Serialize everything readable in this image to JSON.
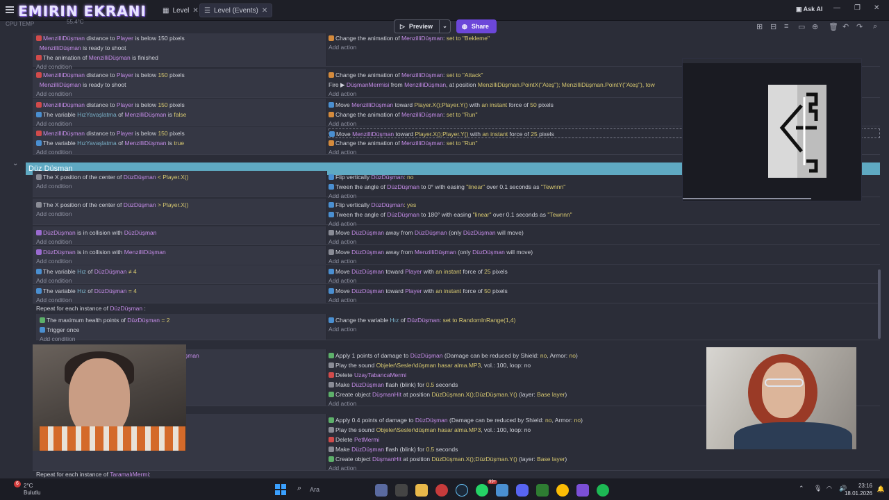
{
  "stream": {
    "title": "EMIRIN EKRANI",
    "temp": "55.4°C",
    "sys": "CPU TEMP"
  },
  "tabs": [
    {
      "label": "Level",
      "active": false
    },
    {
      "label": "Level (Events)",
      "active": true
    }
  ],
  "toolbar": {
    "preview": "Preview",
    "share": "Share",
    "ask_ai": "Ask AI"
  },
  "events": {
    "r1": {
      "c1": "MenzilliDüşman",
      "c1b": "distance to",
      "c1c": "Player",
      "c1d": "is below 150 pixels",
      "c2a": "MenzilliDüşman",
      "c2b": "is ready to shoot",
      "c3a": "The animation of",
      "c3b": "MenzilliDüşman",
      "c3c": "is finished",
      "a1": "Change the animation of",
      "a1b": "MenzilliDüşman",
      "a1c": "set to",
      "a1d": "\"Bekleme\""
    },
    "r2": {
      "c1": "MenzilliDüşman",
      "c1b": "distance to",
      "c1c": "Player",
      "c1d": "is below",
      "c1e": "150",
      "c1f": "pixels",
      "c2a": "MenzilliDüşman",
      "c2b": "is ready to shoot",
      "a1": "Change the animation of",
      "a1b": "MenzilliDüşman",
      "a1c": "set to",
      "a1d": "\"Attack\"",
      "a2": "Fire",
      "a2b": "DüşmanMermisi",
      "a2c": "from",
      "a2d": "MenzilliDüşman",
      "a2e": ", at position",
      "a2f": "MenzilliDüşman.PointX(\"Ateş\"); MenzilliDüşman.PointY(\"Ateş\"), tow"
    },
    "r3": {
      "c1": "MenzilliDüşman",
      "c1b": "distance to",
      "c1c": "Player",
      "c1d": "is below",
      "c1e": "150",
      "c1f": "pixels",
      "c2a": "The variable",
      "c2b": "HızYavaşlatma",
      "c2c": "of",
      "c2d": "MenzilliDüşman",
      "c2e": "is",
      "c2f": "false",
      "a1": "Move",
      "a1b": "MenzilliDüşman",
      "a1c": "toward",
      "a1d": "Player.X();Player.Y()",
      "a1e": "with",
      "a1f": "an instant",
      "a1g": "force of",
      "a1h": "50",
      "a1i": "pixels",
      "a2": "Change the animation of",
      "a2b": "MenzilliDüşman",
      "a2c": "set to",
      "a2d": "\"Run\""
    },
    "r4": {
      "c1": "MenzilliDüşman",
      "c1b": "distance to",
      "c1c": "Player",
      "c1d": "is below",
      "c1e": "150",
      "c1f": "pixels",
      "c2a": "The variable",
      "c2b": "HızYavaşlatma",
      "c2c": "of",
      "c2d": "MenzilliDüşman",
      "c2e": "is",
      "c2f": "true",
      "a1": "Move",
      "a1b": "MenzilliDüşman",
      "a1c": "toward",
      "a1d": "Player.X();Player.Y()",
      "a1e": "with",
      "a1f": "an instant",
      "a1g": "force of",
      "a1h": "25",
      "a1i": "pixels",
      "a2": "Change the animation of",
      "a2b": "MenzilliDüşman",
      "a2c": "set to",
      "a2d": "\"Run\""
    },
    "group": "Düz Düşman",
    "g1": {
      "c1": "The X position of the center of",
      "c1b": "DüzDüşman",
      "c1c": "< Player.X()",
      "a1": "Flip vertically",
      "a1b": "DüzDüşman",
      "a1c": ": no",
      "a2": "Tween the angle of",
      "a2b": "DüzDüşman",
      "a2c": "to 0° with easing",
      "a2d": "\"linear\"",
      "a2e": "over 0.1 seconds as",
      "a2f": "\"Tewnnn\""
    },
    "g2": {
      "c1": "The X position of the center of",
      "c1b": "DüzDüşman",
      "c1c": "> Player.X()",
      "a1": "Flip vertically",
      "a1b": "DüzDüşman",
      "a1c": ": yes",
      "a2": "Tween the angle of",
      "a2b": "DüzDüşman",
      "a2c": "to 180° with easing",
      "a2d": "\"linear\"",
      "a2e": "over 0.1 seconds as",
      "a2f": "\"Tewnnn\""
    },
    "g3": {
      "c1": "DüzDüşman",
      "c1b": "is in collision with",
      "c1c": "DüzDüşman",
      "a1": "Move",
      "a1b": "DüzDüşman",
      "a1c": "away from",
      "a1d": "DüzDüşman",
      "a1e": "(only",
      "a1f": "DüzDüşman",
      "a1g": "will move)"
    },
    "g4": {
      "c1": "DüzDüşman",
      "c1b": "is in collision with",
      "c1c": "MenzilliDüşman",
      "a1": "Move",
      "a1b": "DüzDüşman",
      "a1c": "away from",
      "a1d": "MenzilliDüşman",
      "a1e": "(only",
      "a1f": "DüzDüşman",
      "a1g": "will move)"
    },
    "g5": {
      "c1": "The variable",
      "c1b": "Hız",
      "c1c": "of",
      "c1d": "DüzDüşman",
      "c1e": "≠ 4",
      "a1": "Move",
      "a1b": "DüzDüşman",
      "a1c": "toward",
      "a1d": "Player",
      "a1e": "with",
      "a1f": "an instant",
      "a1g": "force of",
      "a1h": "25",
      "a1i": "pixels"
    },
    "g6": {
      "c1": "The variable",
      "c1b": "Hız",
      "c1c": "of",
      "c1d": "DüzDüşman",
      "c1e": "= 4",
      "a1": "Move",
      "a1b": "DüzDüşman",
      "a1c": "toward",
      "a1d": "Player",
      "a1e": "with",
      "a1f": "an instant",
      "a1g": "force of",
      "a1h": "50",
      "a1i": "pixels"
    },
    "repeat1": {
      "a": "Repeat for each instance of",
      "b": "DüzDüşman",
      "c": ":"
    },
    "g7": {
      "c1": "The maximum health points of",
      "c1b": "DüzDüşman",
      "c1c": "= 2",
      "c2": "Trigger once",
      "a1": "Change the variable",
      "a1b": "Hız",
      "a1c": "of",
      "a1d": "DüzDüşman",
      "a1e": "set to",
      "a1f": "RandomInRange(1,4)"
    },
    "g8": {
      "c1": "şman",
      "a1": "Apply 1 points of damage to",
      "a1b": "DüzDüşman",
      "a1c": "(Damage can be reduced by Shield:",
      "a1d": "no",
      "a1e": ", Armor:",
      "a1f": "no",
      "a1g": ")",
      "a2": "Play the sound",
      "a2b": "Objeler\\Sesler\\düşman hasar alma.MP3",
      "a2c": ", vol.: 100, loop: no",
      "a3": "Delete",
      "a3b": "UzayTabancaMermi",
      "a4": "Make",
      "a4b": "DüzDüşman",
      "a4c": "flash (blink) for",
      "a4d": "0.5",
      "a4e": "seconds",
      "a5": "Create object",
      "a5b": "DüşmanHit",
      "a5c": "at position",
      "a5d": "DüzDüşman.X();DüzDüşman.Y()",
      "a5e": "(layer:",
      "a5f": "Base layer",
      "a5g": ")"
    },
    "g9": {
      "a1": "Apply 0.4 points of damage to",
      "a1b": "DüzDüşman",
      "a1c": "(Damage can be reduced by Shield:",
      "a1d": "no",
      "a1e": ", Armor:",
      "a1f": "no",
      "a1g": ")",
      "a2": "Play the sound",
      "a2b": "Objeler\\Sesler\\düşman hasar alma.MP3",
      "a2c": ", vol.: 100, loop: no",
      "a3": "Delete",
      "a3b": "PetMermi",
      "a4": "Make",
      "a4b": "DüzDüşman",
      "a4c": "flash (blink) for",
      "a4d": "0.5",
      "a4e": "seconds",
      "a5": "Create object",
      "a5b": "DüşmanHit",
      "a5c": "at position",
      "a5d": "DüzDüşman.X();DüzDüşman.Y()",
      "a5e": "(layer:",
      "a5f": "Base layer",
      "a5g": ")"
    },
    "repeat2": {
      "a": "Repeat for each instance of",
      "b": "TaramalıMermi",
      "c": ":"
    },
    "add_condition": "Add condition",
    "add_action": "Add action"
  },
  "taskbar": {
    "weather_temp": "2°C",
    "weather_text": "Bulutlu",
    "badge": "6",
    "search": "Ara",
    "time": "23:16",
    "date": "18.01.2026",
    "notif": "99+"
  },
  "colors": {
    "group_header": "#5fa9c2",
    "share": "#6c47d9",
    "object": "#c58ce8"
  }
}
